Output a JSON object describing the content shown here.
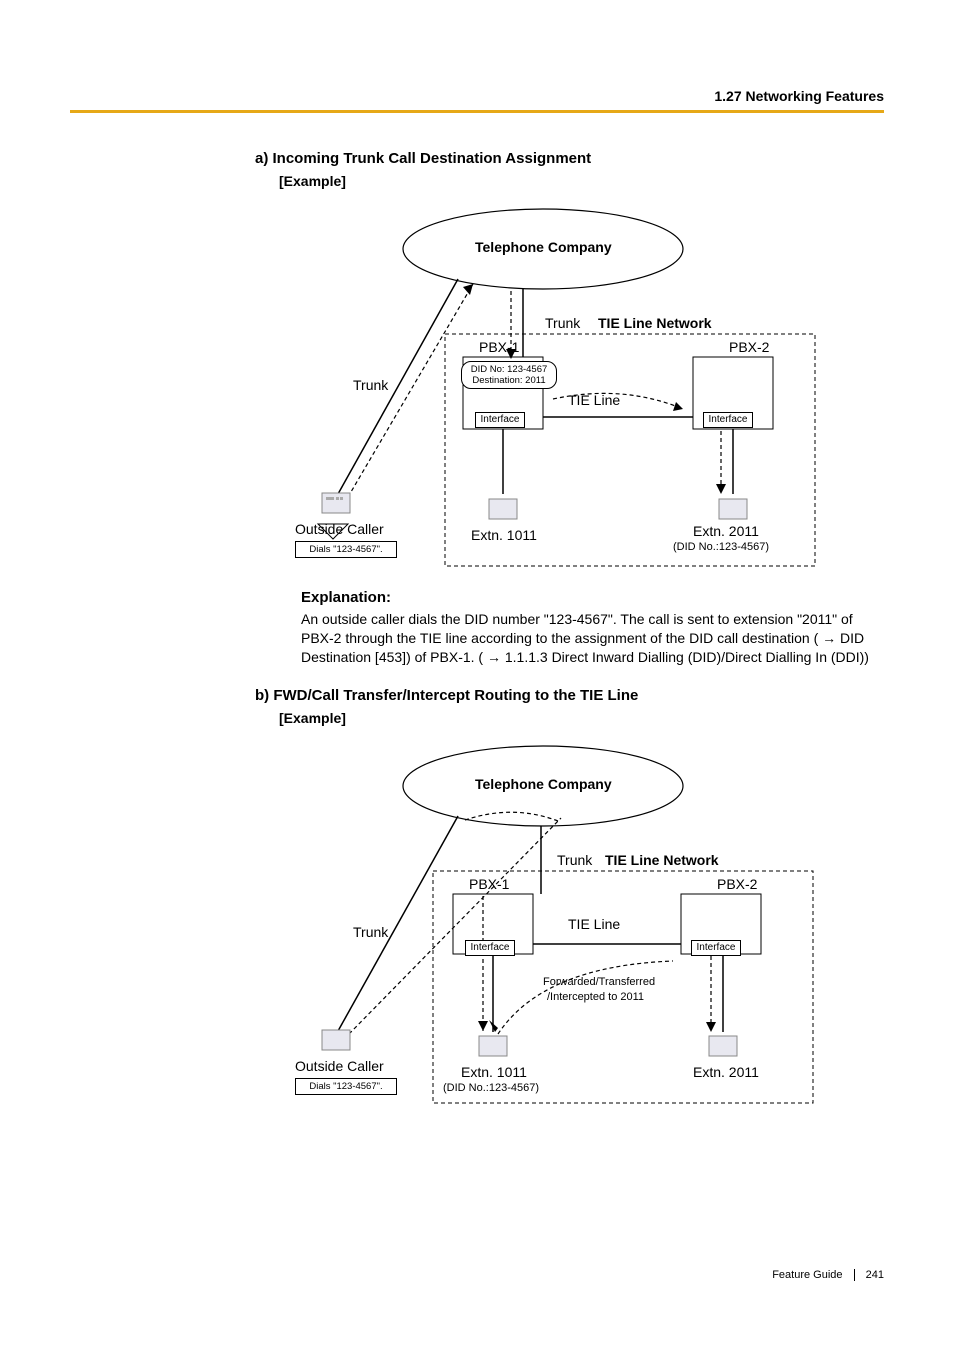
{
  "header": {
    "section": "1.27 Networking Features"
  },
  "sectionA": {
    "title": "a) Incoming Trunk Call Destination Assignment",
    "example": "[Example]"
  },
  "diagramA": {
    "telco": "Telephone Company",
    "trunkLeft": "Trunk",
    "trunkTop": "Trunk",
    "tieNetwork": "TIE Line Network",
    "pbx1": "PBX-1",
    "pbx2": "PBX-2",
    "did1": "DID No: 123-4567",
    "did2": "Destination: 2011",
    "tieLine": "TIE Line",
    "interface1": "Interface",
    "interface2": "Interface",
    "outsideCaller": "Outside Caller",
    "dials": "Dials \"123-4567\".",
    "extn1011": "Extn. 1011",
    "extn2011": "Extn. 2011",
    "didNo2011": "(DID No.:123-4567)"
  },
  "explanationA": {
    "title": "Explanation:",
    "text": "An outside caller dials the DID number \"123-4567\". The call is sent to extension \"2011\" of PBX-2 through the TIE line according to the assignment of the DID call destination ( → DID Destination [453]) of PBX-1. ( → 1.1.1.3 Direct Inward Dialling (DID)/Direct Dialling In (DDI))"
  },
  "sectionB": {
    "title": "b) FWD/Call Transfer/Intercept Routing to the TIE Line",
    "example": "[Example]"
  },
  "diagramB": {
    "telco": "Telephone Company",
    "trunkLeft": "Trunk",
    "trunkTop": "Trunk",
    "tieNetwork": "TIE Line Network",
    "pbx1": "PBX-1",
    "pbx2": "PBX-2",
    "tieLine": "TIE Line",
    "interface1": "Interface",
    "interface2": "Interface",
    "fwd1": "Forwarded/Transferred",
    "fwd2": "/Intercepted to 2011",
    "outsideCaller": "Outside Caller",
    "dials": "Dials \"123-4567\".",
    "extn1011": "Extn. 1011",
    "didNo1011": "(DID No.:123-4567)",
    "extn2011": "Extn. 2011"
  },
  "footer": {
    "guide": "Feature Guide",
    "page": "241"
  }
}
